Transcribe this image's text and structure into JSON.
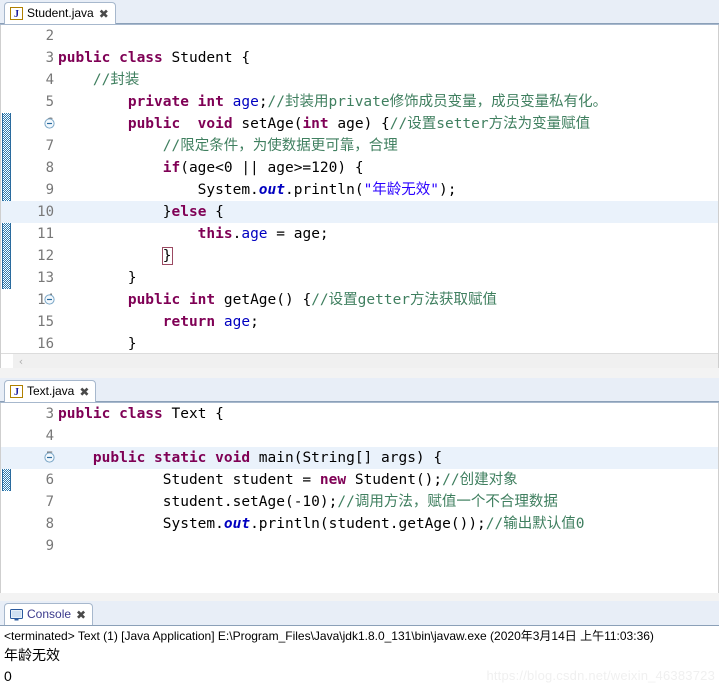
{
  "window": {
    "app": "Eclipse IDE",
    "watermark": "https://blog.csdn.net/weixin_46383723"
  },
  "editors": [
    {
      "tab": {
        "label": "Student.java",
        "icon": "java-file-icon",
        "close_label": "✖",
        "active": true
      },
      "first_visible_line": 2,
      "highlighted_line": 10,
      "change_bar_lines": [
        6,
        7,
        8,
        9,
        10,
        11,
        12,
        13
      ],
      "fold_lines": [
        6,
        14
      ],
      "lines": [
        {
          "n": 2,
          "text": ""
        },
        {
          "n": 3,
          "text": "public class Student {"
        },
        {
          "n": 4,
          "text": "    //封装"
        },
        {
          "n": 5,
          "text": "        private int age;//封装用private修饰成员变量，成员变量私有化。"
        },
        {
          "n": 6,
          "text": "        public  void setAge(int age) {//设置setter方法为变量赋值"
        },
        {
          "n": 7,
          "text": "            //限定条件，为使数据更可靠，合理"
        },
        {
          "n": 8,
          "text": "            if(age<0 || age>=120) {"
        },
        {
          "n": 9,
          "text": "                System.out.println(\"年龄无效\");"
        },
        {
          "n": 10,
          "text": "            }else {"
        },
        {
          "n": 11,
          "text": "                this.age = age;"
        },
        {
          "n": 12,
          "text": "            }"
        },
        {
          "n": 13,
          "text": "        }"
        },
        {
          "n": 14,
          "text": "        public int getAge() {//设置getter方法获取赋值"
        },
        {
          "n": 15,
          "text": "            return age;"
        },
        {
          "n": 16,
          "text": "        }"
        }
      ],
      "hscroll": {
        "left_arrow": "‹"
      }
    },
    {
      "tab": {
        "label": "Text.java",
        "icon": "java-file-icon",
        "close_label": "✖",
        "active": true
      },
      "first_visible_line": 3,
      "highlighted_line": 5,
      "change_bar_lines": [
        5,
        6
      ],
      "fold_lines": [
        5
      ],
      "lines": [
        {
          "n": 3,
          "text": "public class Text {"
        },
        {
          "n": 4,
          "text": ""
        },
        {
          "n": 5,
          "text": "    public static void main(String[] args) {"
        },
        {
          "n": 6,
          "text": "            Student student = new Student();//创建对象"
        },
        {
          "n": 7,
          "text": "            student.setAge(-10);//调用方法，赋值一个不合理数据"
        },
        {
          "n": 8,
          "text": "            System.out.println(student.getAge());//输出默认值0"
        },
        {
          "n": 9,
          "text": ""
        }
      ],
      "hscroll": {
        "left_arrow": ""
      }
    }
  ],
  "console": {
    "tab": {
      "label": "Console",
      "icon": "console-icon",
      "close_label": "✖"
    },
    "status_line": "<terminated> Text (1) [Java Application] E:\\Program_Files\\Java\\jdk1.8.0_131\\bin\\javaw.exe (2020年3月14日 上午11:03:36)",
    "output": [
      "年龄无效",
      "0"
    ]
  },
  "theme": {
    "keyword": "#7f0055",
    "field": "#0000c0",
    "string": "#2a00ff",
    "comment": "#3f7f5f",
    "line_number": "#787878",
    "current_line_bg": "#eaf2fb",
    "tabbar_bg": "#e8eef7",
    "change_bar": "#2a7ab0"
  }
}
